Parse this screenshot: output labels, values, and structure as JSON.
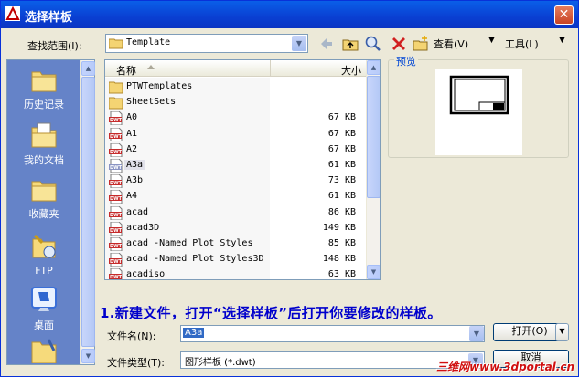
{
  "window": {
    "title": "选择样板"
  },
  "lookin": {
    "label": "查找范围(I):",
    "value": "Template"
  },
  "toolbar": {
    "view_label": "查看(V)",
    "tools_label": "工具(L)"
  },
  "places": [
    {
      "label": "历史记录",
      "icon": "history-folder-icon"
    },
    {
      "label": "我的文档",
      "icon": "documents-folder-icon"
    },
    {
      "label": "收藏夹",
      "icon": "favorites-folder-icon"
    },
    {
      "label": "FTP",
      "icon": "ftp-icon"
    },
    {
      "label": "桌面",
      "icon": "desktop-icon"
    }
  ],
  "filelist": {
    "col_name": "名称",
    "col_size": "大小",
    "rows": [
      {
        "name": "PTWTemplates",
        "size": "",
        "type": "folder"
      },
      {
        "name": "SheetSets",
        "size": "",
        "type": "folder"
      },
      {
        "name": "A0",
        "size": "67 KB",
        "type": "dwt"
      },
      {
        "name": "A1",
        "size": "67 KB",
        "type": "dwt"
      },
      {
        "name": "A2",
        "size": "67 KB",
        "type": "dwt"
      },
      {
        "name": "A3a",
        "size": "61 KB",
        "type": "dwt-selected"
      },
      {
        "name": "A3b",
        "size": "73 KB",
        "type": "dwt"
      },
      {
        "name": "A4",
        "size": "61 KB",
        "type": "dwt"
      },
      {
        "name": "acad",
        "size": "86 KB",
        "type": "dwt"
      },
      {
        "name": "acad3D",
        "size": "149 KB",
        "type": "dwt"
      },
      {
        "name": "acad -Named Plot Styles",
        "size": "85 KB",
        "type": "dwt"
      },
      {
        "name": "acad -Named Plot Styles3D",
        "size": "148 KB",
        "type": "dwt"
      },
      {
        "name": "acadiso",
        "size": "63 KB",
        "type": "dwt"
      }
    ]
  },
  "preview": {
    "label": "预览"
  },
  "instruction": "1.新建文件，打开“选择样板”后打开你要修改的样板。",
  "filename": {
    "label": "文件名(N):",
    "value": "A3a"
  },
  "filetype": {
    "label": "文件类型(T):",
    "value": "图形样板 (*.dwt)"
  },
  "buttons": {
    "open": "打开(O)",
    "cancel": "取消"
  },
  "watermark": "三维网www.3dportal.cn",
  "colors": {
    "title_bar": "#0a3fd2",
    "places_bg": "#6583c8",
    "instruction": "#0000cc",
    "watermark": "#d01010"
  }
}
